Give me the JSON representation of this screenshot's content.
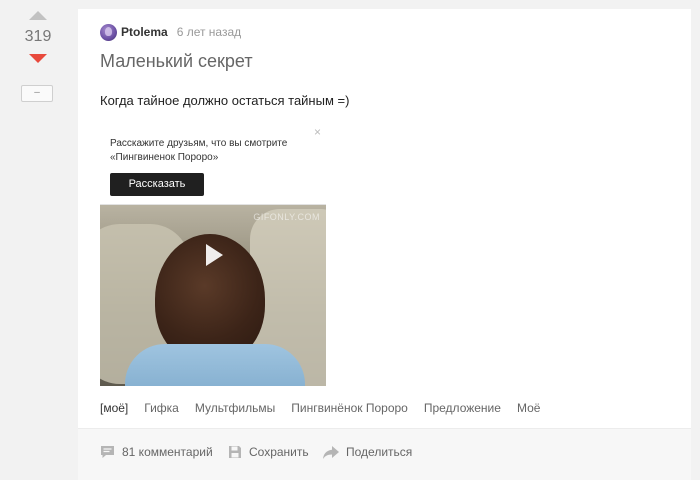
{
  "rating": {
    "value": "319",
    "hide_label": "–"
  },
  "story": {
    "author": "Ptolema",
    "time": "6 лет назад",
    "title": "Маленький секрет",
    "text": "Когда тайное должно остаться тайным =)",
    "gif": {
      "popup_text": "Расскажите друзьям, что вы смотрите «Пингвиненок Пороро»",
      "popup_button": "Рассказать",
      "close": "×",
      "watermark": "GIFONLY.COM"
    },
    "tags": [
      "[моё]",
      "Гифка",
      "Мультфильмы",
      "Пингвинёнок Пороро",
      "Предложение",
      "Моё"
    ]
  },
  "footer": {
    "comments": "81 комментарий",
    "save": "Сохранить",
    "share": "Поделиться"
  },
  "colors": {
    "downvote": "#e8493c",
    "upvote": "#c2c2c2",
    "background": "#f2f2f2"
  }
}
